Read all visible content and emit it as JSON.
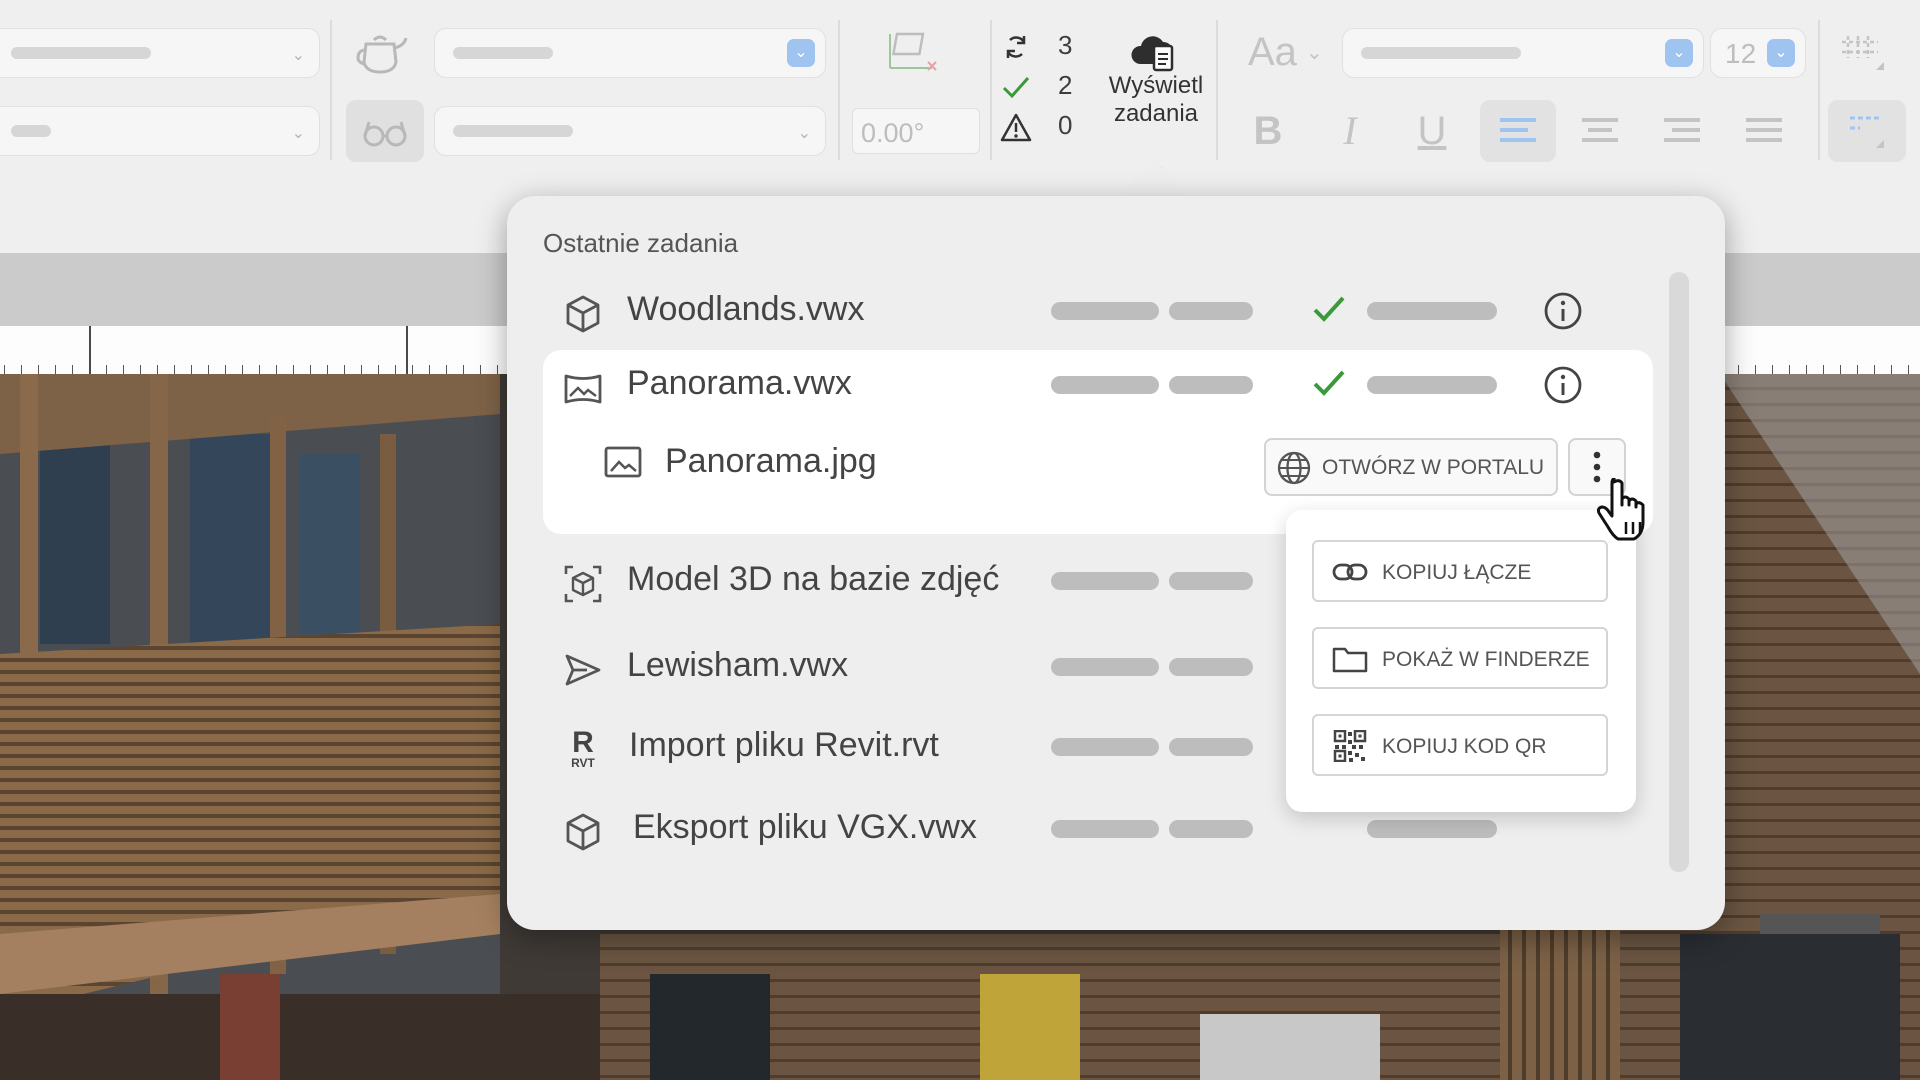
{
  "toolbar": {
    "angle_value": "0.00°",
    "font_icon_label": "Aa",
    "font_size": "12",
    "status": {
      "in_progress_count": "3",
      "done_count": "2",
      "warning_count": "0"
    },
    "tasks_button_label_line1": "Wyświetl",
    "tasks_button_label_line2": "zadania",
    "format_buttons": [
      "B",
      "I",
      "U"
    ]
  },
  "popup": {
    "title": "Ostatnie zadania",
    "tasks": [
      {
        "name": "Woodlands.vwx",
        "icon": "cube-icon",
        "status": "done"
      },
      {
        "name": "Panorama.vwx",
        "icon": "panorama-image-icon",
        "status": "done",
        "selected": true
      },
      {
        "name": "Model 3D na bazie zdjęć",
        "icon": "photo-3d-model-icon"
      },
      {
        "name": "Lewisham.vwx",
        "icon": "send-arrow-icon"
      },
      {
        "name": "Import pliku Revit.rvt",
        "icon": "revit-icon"
      },
      {
        "name": "Eksport pliku VGX.vwx",
        "icon": "cube-icon"
      }
    ],
    "subitem": {
      "name": "Panorama.jpg",
      "icon": "image-icon"
    },
    "revit_icon_letter": "R",
    "revit_icon_sub": "RVT",
    "open_portal_label": "OTWÓRZ W PORTALU",
    "menu": [
      {
        "label": "KOPIUJ ŁĄCZE",
        "icon": "link-icon"
      },
      {
        "label": "POKAŻ W FINDERZE",
        "icon": "folder-icon"
      },
      {
        "label": "KOPIUJ KOD QR",
        "icon": "qr-code-icon"
      }
    ]
  },
  "colors": {
    "accent_blue": "#9fc4f0",
    "success_green": "#3a9a3a",
    "toolbar_bg": "#efefef",
    "popup_bg": "#eeeeee"
  }
}
